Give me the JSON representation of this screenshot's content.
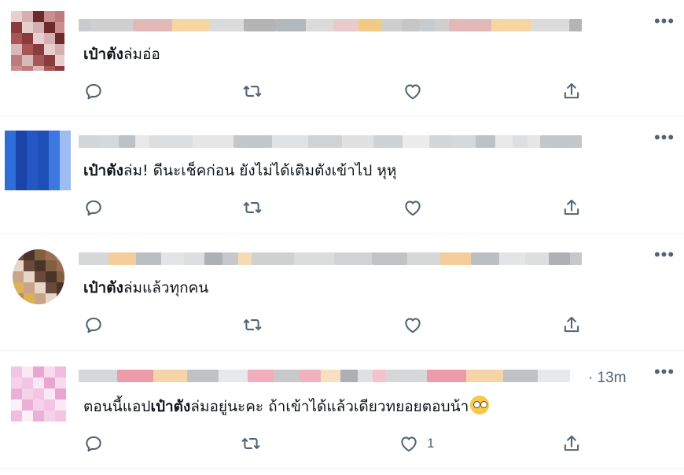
{
  "tweets": [
    {
      "text_bold": "เป๋าตัง",
      "text_rest": "ล่มอ่อ",
      "timestamp": "",
      "like_count": "",
      "avatar_colors": [
        "#e8cfcf",
        "#c98f8f",
        "#a85555",
        "#d6b0b0",
        "#bf7b7b",
        "#8a3b3b",
        "#6e2b2b",
        "#d8b8b8"
      ],
      "name_colors": [
        "#9aa0a6",
        "#c7c7c7",
        "#d9a0a0",
        "#f0c070",
        "#bdbdbd",
        "#a7a7a7"
      ]
    },
    {
      "text_bold": "เป๋าตัง",
      "text_rest": "ล่ม! ดีนะเช็คก่อน ยังไม่ได้เติมตังเข้าไป หุหุ",
      "timestamp": "",
      "like_count": "",
      "avatar_colors": [
        "#2f6ed8",
        "#1f4fb8",
        "#5a8ee8",
        "#1a44a8",
        "#3b79e0",
        "#7aa6ee",
        "#2456c4",
        "#9cbcf2"
      ],
      "name_colors": [
        "#b0b4b8",
        "#cfd2d5",
        "#a9adb1",
        "#dcdcdc",
        "#bfc3c6",
        "#e2e2e2"
      ]
    },
    {
      "text_bold": "เป๋าตัง",
      "text_rest": "ล่มแล้วทุกคน",
      "timestamp": "",
      "like_count": "",
      "avatar_colors": [
        "#6a4a3a",
        "#9b6e55",
        "#c9a48a",
        "#4a3328",
        "#b98a6a",
        "#e6d7c8",
        "#806040",
        "#d9b25a"
      ],
      "name_colors": [
        "#b3b6b9",
        "#f2c48a",
        "#a6a9ac",
        "#d4d6d8",
        "#c0c3c6",
        "#9fa3a6"
      ]
    },
    {
      "text_bold": "เป๋าตัง",
      "text_prefix": "ตอนนี้แอป",
      "text_rest": "ล่มอยู่นะคะ ถ้าเข้าได้แล้วเดียวทยอยตอบน้า",
      "timestamp": "· 13m",
      "like_count": "1",
      "avatar_colors": [
        "#f4c4e4",
        "#f8dbee",
        "#eab0d8",
        "#fbe8f4",
        "#f0bde0",
        "#f6d2ea",
        "#e8a6d2",
        "#fdf0f8"
      ],
      "name_colors": [
        "#b4b7ba",
        "#e88a9a",
        "#f3c58a",
        "#9ea2a5",
        "#d3d5d7",
        "#f0a0b0"
      ]
    }
  ],
  "icons": {
    "reply": "reply-icon",
    "retweet": "retweet-icon",
    "like": "heart-icon",
    "share": "share-icon",
    "more": "more-icon"
  },
  "menu_glyph": "•••"
}
